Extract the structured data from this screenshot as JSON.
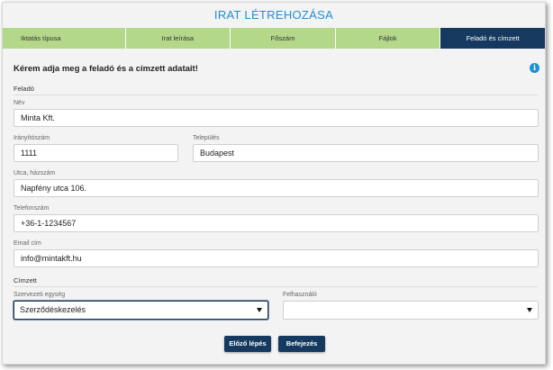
{
  "dialog": {
    "title": "IRAT LÉTREHOZÁSA"
  },
  "steps": [
    {
      "label": "Iktatás típusa",
      "active": false
    },
    {
      "label": "Irat leírása",
      "active": false
    },
    {
      "label": "Főszám",
      "active": false
    },
    {
      "label": "Fájlok",
      "active": false
    },
    {
      "label": "Feladó és címzett",
      "active": true
    }
  ],
  "form": {
    "heading": "Kérem adja meg a feladó és a címzett adatait!",
    "info_icon": "info-icon",
    "sender": {
      "section_label": "Feladó",
      "name_label": "Név",
      "name_value": "Minta Kft.",
      "zip_label": "Irányítószám",
      "zip_value": "1111",
      "city_label": "Település",
      "city_value": "Budapest",
      "street_label": "Utca, házszám",
      "street_value": "Napfény utca 106.",
      "phone_label": "Telefonszám",
      "phone_value": "+36-1-1234567",
      "email_label": "Email cím",
      "email_value": "info@mintakft.hu"
    },
    "recipient": {
      "section_label": "Címzett",
      "unit_label": "Szervezeti egység",
      "unit_value": "Szerződéskezelés",
      "user_label": "Felhasználó",
      "user_value": ""
    }
  },
  "buttons": {
    "prev_label": "Előző lépés",
    "finish_label": "Befejezés"
  },
  "colors": {
    "accent": "#1f8fd6",
    "step_inactive": "#b4d88a",
    "step_active": "#16395f",
    "button": "#16395f"
  }
}
